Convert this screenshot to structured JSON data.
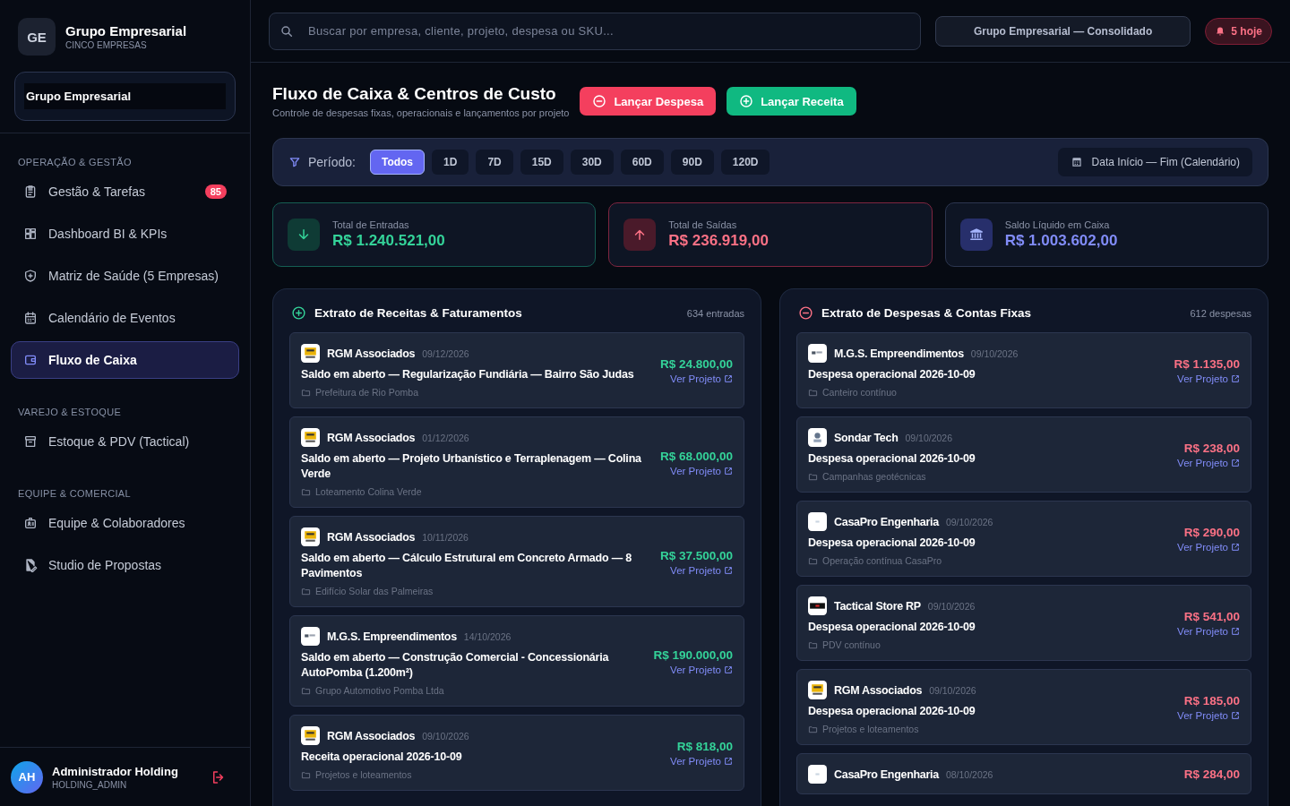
{
  "brand": {
    "initials": "GE",
    "name": "Grupo Empresarial",
    "subtitle": "CINCO EMPRESAS",
    "selector": "Grupo Empresarial"
  },
  "sidebar": {
    "sections": [
      {
        "label": "OPERAÇÃO & GESTÃO",
        "items": [
          {
            "kind": "clipboard",
            "label": "Gestão & Tarefas",
            "badge": "85",
            "selected": false
          },
          {
            "kind": "grid",
            "label": "Dashboard BI & KPIs",
            "selected": false
          },
          {
            "kind": "shield",
            "label": "Matriz de Saúde (5 Empresas)",
            "selected": false
          },
          {
            "kind": "calendar",
            "label": "Calendário de Eventos",
            "selected": false
          },
          {
            "kind": "wallet",
            "label": "Fluxo de Caixa",
            "selected": true
          }
        ]
      },
      {
        "label": "VAREJO & ESTOQUE",
        "items": [
          {
            "kind": "archive",
            "label": "Estoque & PDV (Tactical)",
            "selected": false
          }
        ]
      },
      {
        "label": "EQUIPE & COMERCIAL",
        "items": [
          {
            "kind": "team",
            "label": "Equipe & Colaboradores",
            "selected": false
          },
          {
            "kind": "document",
            "label": "Studio de Propostas",
            "selected": false
          }
        ]
      }
    ]
  },
  "user": {
    "initials": "AH",
    "name": "Administrador Holding",
    "role": "HOLDING_ADMIN"
  },
  "search": {
    "placeholder": "Buscar por empresa, cliente, projeto, despesa ou SKU..."
  },
  "company_switch": "Grupo Empresarial — Consolidado",
  "alerts": "5 hoje",
  "page": {
    "title": "Fluxo de Caixa & Centros de Custo",
    "subtitle": "Controle de despesas fixas, operacionais e lançamentos por projeto"
  },
  "actions": [
    {
      "kind": "expense",
      "label": "Lançar Despesa"
    },
    {
      "kind": "income",
      "label": "Lançar Receita"
    }
  ],
  "period": {
    "label": "Período:",
    "options": [
      {
        "label": "Todos",
        "selected": true
      },
      {
        "label": "1D",
        "selected": false
      },
      {
        "label": "7D",
        "selected": false
      },
      {
        "label": "15D",
        "selected": false
      },
      {
        "label": "30D",
        "selected": false
      },
      {
        "label": "60D",
        "selected": false
      },
      {
        "label": "90D",
        "selected": false
      },
      {
        "label": "120D",
        "selected": false
      }
    ],
    "range": "Data Início — Fim (Calendário)"
  },
  "stats": [
    {
      "kind": "in",
      "label": "Total de Entradas",
      "value": "R$ 1.240.521,00"
    },
    {
      "kind": "out",
      "label": "Total de Saídas",
      "value": "R$ 236.919,00"
    },
    {
      "kind": "balance",
      "label": "Saldo Líquido em Caixa",
      "value": "R$ 1.003.602,00"
    }
  ],
  "ledgers": [
    {
      "kind": "income",
      "title": "Extrato de Receitas & Faturamentos",
      "count": "634 entradas",
      "entries": [
        {
          "kind": "rgm",
          "company": "RGM Associados",
          "date": "09/12/2026",
          "description": "Saldo em aberto — Regularização Fundiária — Bairro São Judas",
          "project": "Prefeitura de Rio Pomba",
          "amount": "R$ 24.800,00",
          "link": "Ver Projeto"
        },
        {
          "kind": "rgm",
          "company": "RGM Associados",
          "date": "01/12/2026",
          "description": "Saldo em aberto — Projeto Urbanístico e Terraplenagem — Colina Verde",
          "project": "Loteamento Colina Verde",
          "amount": "R$ 68.000,00",
          "link": "Ver Projeto"
        },
        {
          "kind": "rgm",
          "company": "RGM Associados",
          "date": "10/11/2026",
          "description": "Saldo em aberto — Cálculo Estrutural em Concreto Armado — 8 Pavimentos",
          "project": "Edifício Solar das Palmeiras",
          "amount": "R$ 37.500,00",
          "link": "Ver Projeto"
        },
        {
          "kind": "mgs",
          "company": "M.G.S. Empreendimentos",
          "date": "14/10/2026",
          "description": "Saldo em aberto — Construção Comercial - Concessionária AutoPomba (1.200m²)",
          "project": "Grupo Automotivo Pomba Ltda",
          "amount": "R$ 190.000,00",
          "link": "Ver Projeto"
        },
        {
          "kind": "rgm",
          "company": "RGM Associados",
          "date": "09/10/2026",
          "description": "Receita operacional 2026-10-09",
          "project": "Projetos e loteamentos",
          "amount": "R$ 818,00",
          "link": "Ver Projeto"
        }
      ]
    },
    {
      "kind": "expense",
      "title": "Extrato de Despesas & Contas Fixas",
      "count": "612 despesas",
      "entries": [
        {
          "kind": "mgs",
          "company": "M.G.S. Empreendimentos",
          "date": "09/10/2026",
          "description": "Despesa operacional 2026-10-09",
          "project": "Canteiro contínuo",
          "amount": "R$ 1.135,00",
          "link": "Ver Projeto"
        },
        {
          "kind": "sondar",
          "company": "Sondar Tech",
          "date": "09/10/2026",
          "description": "Despesa operacional 2026-10-09",
          "project": "Campanhas geotécnicas",
          "amount": "R$ 238,00",
          "link": "Ver Projeto"
        },
        {
          "kind": "casapro",
          "company": "CasaPro Engenharia",
          "date": "09/10/2026",
          "description": "Despesa operacional 2026-10-09",
          "project": "Operação contínua CasaPro",
          "amount": "R$ 290,00",
          "link": "Ver Projeto"
        },
        {
          "kind": "tactical",
          "company": "Tactical Store RP",
          "date": "09/10/2026",
          "description": "Despesa operacional 2026-10-09",
          "project": "PDV contínuo",
          "amount": "R$ 541,00",
          "link": "Ver Projeto"
        },
        {
          "kind": "rgm",
          "company": "RGM Associados",
          "date": "09/10/2026",
          "description": "Despesa operacional 2026-10-09",
          "project": "Projetos e loteamentos",
          "amount": "R$ 185,00",
          "link": "Ver Projeto"
        },
        {
          "kind": "casapro",
          "company": "CasaPro Engenharia",
          "date": "08/10/2026",
          "amount": "R$ 284,00"
        }
      ]
    }
  ]
}
